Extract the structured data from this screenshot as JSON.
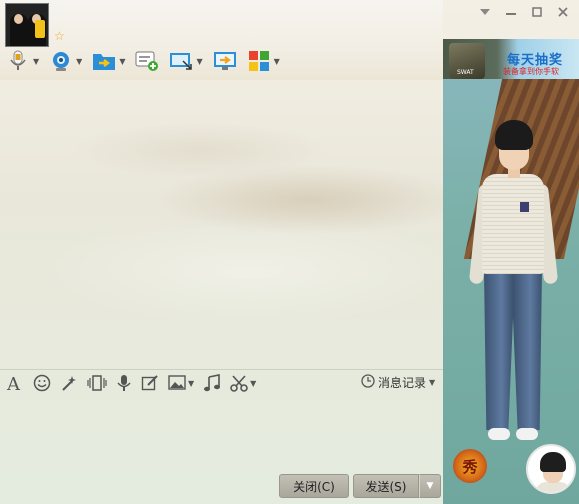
{
  "window": {
    "controls": [
      {
        "name": "dropdown-icon",
        "glyph": "▾"
      },
      {
        "name": "minimize-icon",
        "glyph": "—"
      },
      {
        "name": "maximize-icon",
        "glyph": "☐"
      },
      {
        "name": "close-icon",
        "glyph": "✕"
      }
    ]
  },
  "toolbar": {
    "items": [
      {
        "name": "voice-call",
        "icon": "microphone-icon",
        "has_arrow": true
      },
      {
        "name": "video-call",
        "icon": "webcam-icon",
        "has_arrow": true
      },
      {
        "name": "send-file",
        "icon": "folder-send-icon",
        "has_arrow": true
      },
      {
        "name": "create-discussion",
        "icon": "chat-add-icon",
        "has_arrow": false
      },
      {
        "name": "remote-assist",
        "icon": "remote-desktop-icon",
        "has_arrow": true
      },
      {
        "name": "share-screen",
        "icon": "screen-share-icon",
        "has_arrow": false
      },
      {
        "name": "apps",
        "icon": "apps-grid-icon",
        "has_arrow": true
      }
    ]
  },
  "ad": {
    "title": "每天抽奖",
    "subtitle": "装备拿到你手软",
    "small": "SWAT"
  },
  "badge": {
    "glyph": "秀"
  },
  "format_bar": {
    "items": [
      {
        "name": "font",
        "icon": "font-icon",
        "has_arrow": false
      },
      {
        "name": "emoji",
        "icon": "smiley-icon",
        "has_arrow": false
      },
      {
        "name": "magic",
        "icon": "magic-wand-icon",
        "has_arrow": false
      },
      {
        "name": "shake",
        "icon": "vibrate-icon",
        "has_arrow": false
      },
      {
        "name": "voice-message",
        "icon": "microphone-icon",
        "has_arrow": false
      },
      {
        "name": "doodle",
        "icon": "edit-icon",
        "has_arrow": false
      },
      {
        "name": "image",
        "icon": "image-icon",
        "has_arrow": true
      },
      {
        "name": "music",
        "icon": "music-note-icon",
        "has_arrow": false
      },
      {
        "name": "screenshot",
        "icon": "scissors-icon",
        "has_arrow": true
      }
    ],
    "history_label": "消息记录"
  },
  "buttons": {
    "close_label": "关闭(C)",
    "send_label": "发送(S)"
  },
  "colors": {
    "accent_blue": "#1b6fc8",
    "button_bg": "#b6b3a9",
    "star": "#f1a81b"
  }
}
